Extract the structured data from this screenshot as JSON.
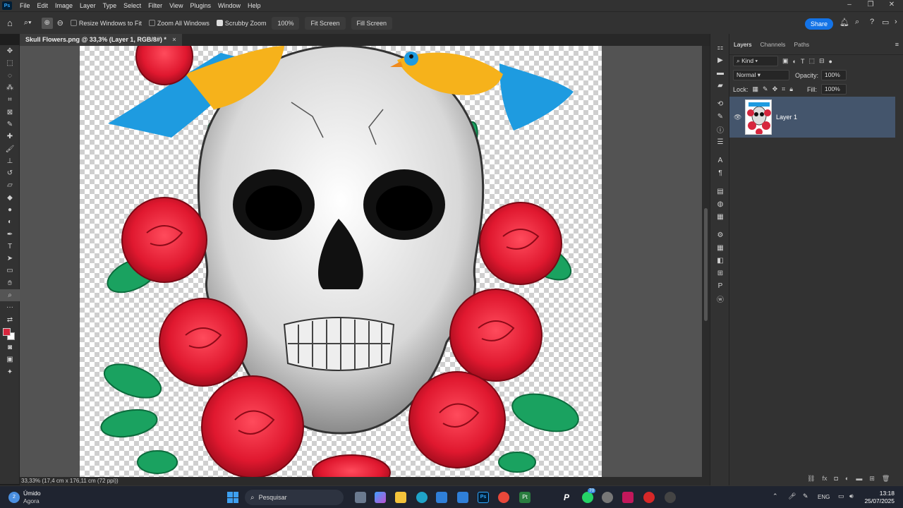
{
  "menubar": {
    "items": [
      "File",
      "Edit",
      "Image",
      "Layer",
      "Type",
      "Select",
      "Filter",
      "View",
      "Plugins",
      "Window",
      "Help"
    ]
  },
  "options": {
    "resize_label": "Resize Windows to Fit",
    "zoom_all_label": "Zoom All Windows",
    "scrubby_label": "Scrubby Zoom",
    "zoom_value": "100%",
    "fit_screen": "Fit Screen",
    "fill_screen": "Fill Screen",
    "share": "Share"
  },
  "document": {
    "tab_title": "Skull Flowers.png @ 33,3% (Layer 1, RGB/8#) *",
    "close": "×"
  },
  "status": {
    "text": "33,33%  (17,4 cm x 176,11 cm (72 ppi))"
  },
  "panel": {
    "tabs": [
      "Layers",
      "Channels",
      "Paths"
    ],
    "kind": "Kind",
    "blend": "Normal",
    "opacity_label": "Opacity:",
    "opacity_value": "100%",
    "lock_label": "Lock:",
    "fill_label": "Fill:",
    "fill_value": "100%",
    "layer_name": "Layer 1"
  },
  "taskbar": {
    "weather_temp": "2",
    "weather_title": "Úmido",
    "weather_sub": "Agora",
    "search_placeholder": "Pesquisar",
    "lang": "ENG",
    "time": "13:18",
    "date": "25/07/2025",
    "badge": "70"
  },
  "colors": {
    "accent": "#1473e6",
    "foreground": "#d7263d",
    "background": "#ffffff",
    "layer_selected": "#44556c"
  }
}
